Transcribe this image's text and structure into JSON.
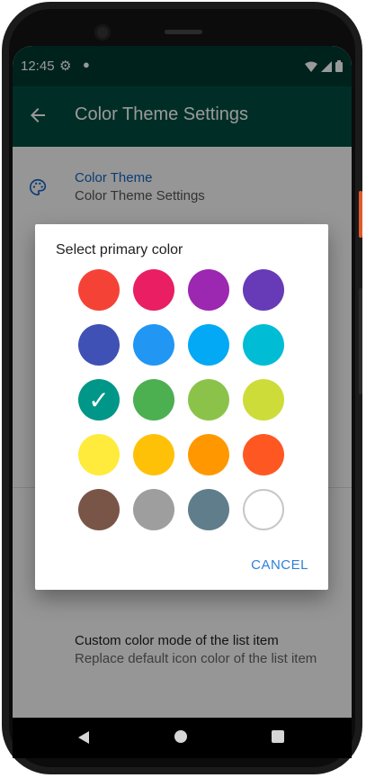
{
  "status_bar": {
    "time": "12:45",
    "icons": [
      "gear-icon",
      "dot-icon",
      "wifi-icon",
      "signal-icon",
      "battery-icon"
    ]
  },
  "app_bar": {
    "title": "Color Theme Settings",
    "back_icon": "arrow-back-icon"
  },
  "list": {
    "items": [
      {
        "title": "Color Theme",
        "subtitle": "Color Theme Settings",
        "icon": "palette-icon"
      },
      {
        "title": "Custom color mode of the list item",
        "subtitle": "Replace default icon color of the list item",
        "icon": ""
      }
    ]
  },
  "dialog": {
    "title": "Select primary color",
    "selected_index": 8,
    "colors": [
      "#f44336",
      "#e91e63",
      "#9c27b0",
      "#673ab7",
      "#3f51b5",
      "#2196f3",
      "#03a9f4",
      "#00bcd4",
      "#009688",
      "#4caf50",
      "#8bc34a",
      "#cddc39",
      "#ffeb3b",
      "#ffc107",
      "#ff9800",
      "#ff5722",
      "#795548",
      "#9e9e9e",
      "#607d8b",
      "#ffffff"
    ],
    "check_mark": "✓",
    "cancel_label": "CANCEL"
  },
  "theme": {
    "status_bar_color": "#003a31",
    "app_bar_color": "#004d40",
    "accent_color": "#2f80d8"
  }
}
